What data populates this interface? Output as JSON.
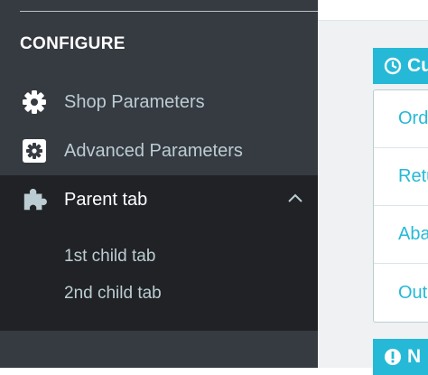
{
  "sidebar": {
    "section_title": "CONFIGURE",
    "items": [
      {
        "label": "Shop Parameters",
        "icon": "gear-icon"
      },
      {
        "label": "Advanced Parameters",
        "icon": "settings-box-icon"
      },
      {
        "label": "Parent tab",
        "icon": "puzzle-icon",
        "expanded": true
      }
    ],
    "children": [
      {
        "label": "1st child tab"
      },
      {
        "label": "2nd child tab"
      }
    ]
  },
  "content": {
    "panel1_title": "Cu",
    "panel1_icon": "clock-icon",
    "rows": [
      {
        "label": "Ord"
      },
      {
        "label": "Retu"
      },
      {
        "label": "Aba"
      },
      {
        "label": "Out"
      }
    ],
    "panel2_title": "N",
    "panel2_icon": "exclamation-icon"
  },
  "colors": {
    "sidebar_bg": "#363a41",
    "active_bg": "#202226",
    "text_muted": "#bbcdd2",
    "accent": "#25b9d7"
  }
}
